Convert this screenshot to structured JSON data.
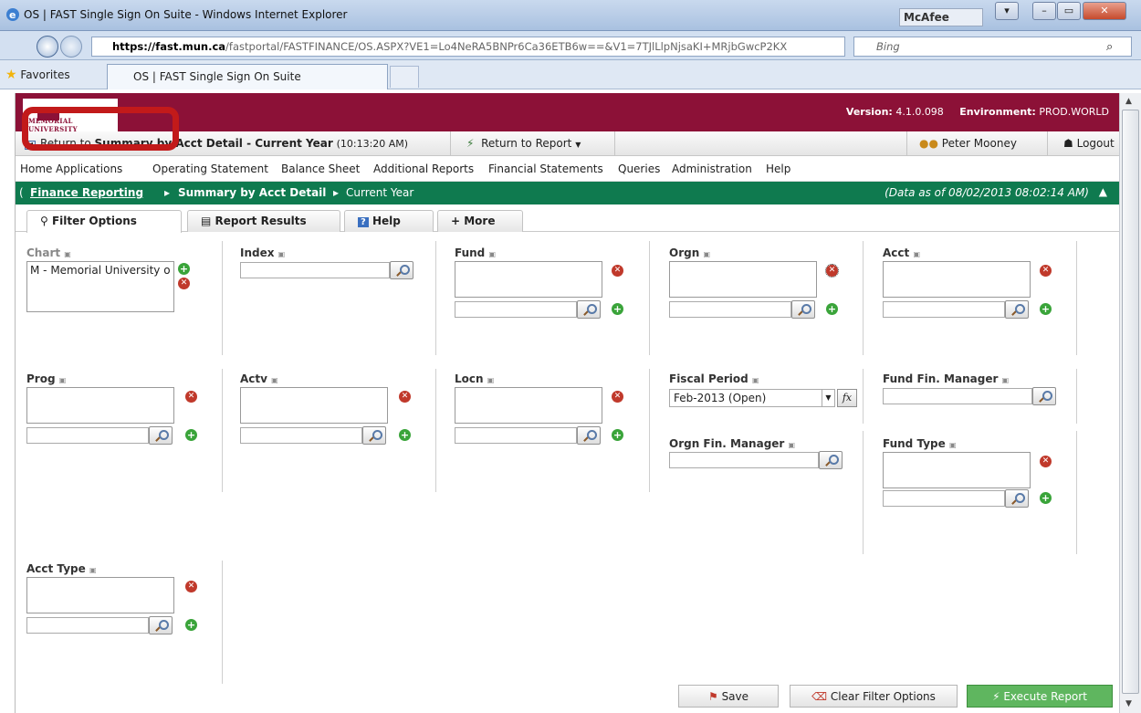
{
  "browser": {
    "title": "OS | FAST Single Sign On Suite - Windows Internet Explorer",
    "mcafee": "McAfee",
    "url_host": "https://fast.mun.ca",
    "url_path": "/fastportal/FASTFINANCE/OS.ASPX?VE1=Lo4NeRA5BNPr6Ca36ETB6w==&V1=7TJlLlpNjsaKI+MRjbGwcP2KX",
    "search_placeholder": "Bing",
    "favorites_label": "Favorites",
    "tab_title": "OS | FAST Single Sign On Suite"
  },
  "header": {
    "logo_text": "MEMORIAL UNIVERSITY",
    "version_label": "Version:",
    "version_value": "4.1.0.098",
    "environment_label": "Environment:",
    "environment_value": "PROD.WORLD"
  },
  "toolbar": {
    "return_prefix": "Return to",
    "return_target": "Summary by Acct Detail - Current Year",
    "return_time": "(10:13:20 AM)",
    "return_to_report": "Return to Report",
    "user": "Peter Mooney",
    "logout": "Logout"
  },
  "menu": [
    "Home",
    "Applications",
    "Operating Statement",
    "Balance Sheet",
    "Additional Reports",
    "Financial Statements",
    "Queries",
    "Administration",
    "Help"
  ],
  "breadcrumb": {
    "root": "Finance Reporting",
    "middle": "Summary by Acct Detail",
    "last": "Current Year",
    "as_of": "(Data as of 08/02/2013 08:02:14 AM)"
  },
  "tabs": [
    "Filter Options",
    "Report Results",
    "Help",
    "+ More"
  ],
  "filters": {
    "chart": {
      "label": "Chart",
      "value": "M - Memorial University o"
    },
    "index": {
      "label": "Index"
    },
    "fund": {
      "label": "Fund"
    },
    "orgn": {
      "label": "Orgn"
    },
    "acct": {
      "label": "Acct"
    },
    "prog": {
      "label": "Prog"
    },
    "actv": {
      "label": "Actv"
    },
    "locn": {
      "label": "Locn"
    },
    "fiscal_period": {
      "label": "Fiscal Period",
      "value": "Feb-2013 (Open)"
    },
    "fund_fin_manager": {
      "label": "Fund Fin. Manager"
    },
    "orgn_fin_manager": {
      "label": "Orgn Fin. Manager"
    },
    "fund_type": {
      "label": "Fund Type"
    },
    "acct_type": {
      "label": "Acct Type"
    }
  },
  "actions": {
    "save": "Save",
    "clear": "Clear Filter Options",
    "execute": "Execute Report"
  },
  "colors": {
    "banner": "#8c1137",
    "breadcrumb": "#0f7a4f",
    "highlight": "#c21a1a",
    "execute": "#5fb65f"
  }
}
